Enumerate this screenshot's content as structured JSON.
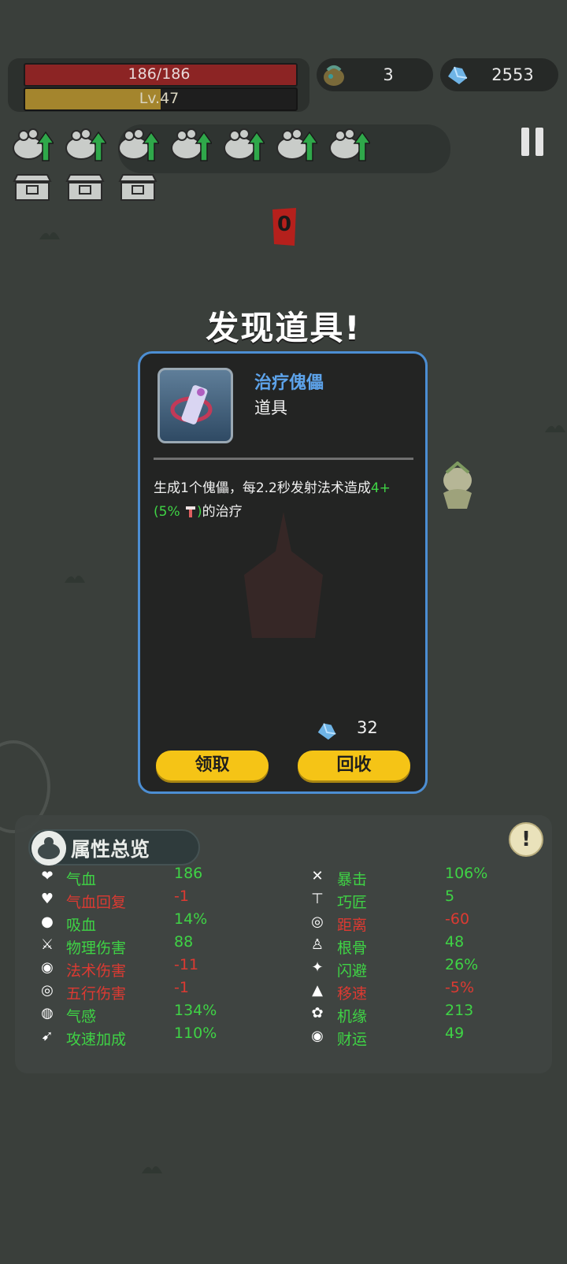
{
  "hud": {
    "hp_text": "186/186",
    "hp_fraction": 1.0,
    "level_text": "Lv.47",
    "level_progress": 0.5,
    "bag_count": "3",
    "crystals": "2553"
  },
  "counter_number": "0",
  "popup": {
    "title": "发现道具!",
    "item_name": "治疗傀儡",
    "item_type": "道具",
    "desc_part1": "生成1个傀儡，每2.2秒发射法术造成",
    "desc_green1": "4+",
    "desc_green2": "(5% ",
    "desc_green3": ")",
    "desc_part2": "的治疗",
    "cost": "32",
    "btn_take": "领取",
    "btn_recycle": "回收"
  },
  "stats": {
    "title": "属性总览",
    "left": [
      {
        "label": "气血",
        "value": "186",
        "color": "#3fd345",
        "icon": "heart-icon"
      },
      {
        "label": "气血回复",
        "value": "-1",
        "color": "#dc3a32",
        "icon": "heart-regen-icon"
      },
      {
        "label": "吸血",
        "value": "14%",
        "color": "#3fd345",
        "icon": "blood-drop-icon"
      },
      {
        "label": "物理伤害",
        "value": "88",
        "color": "#3fd345",
        "icon": "sword-icon"
      },
      {
        "label": "法术伤害",
        "value": "-11",
        "color": "#dc3a32",
        "icon": "spiral-icon"
      },
      {
        "label": "五行伤害",
        "value": "-1",
        "color": "#dc3a32",
        "icon": "element-icon"
      },
      {
        "label": "气感",
        "value": "134%",
        "color": "#3fd345",
        "icon": "qi-icon"
      },
      {
        "label": "攻速加成",
        "value": "110%",
        "color": "#3fd345",
        "icon": "attack-speed-icon"
      }
    ],
    "right": [
      {
        "label": "暴击",
        "value": "106%",
        "color": "#3fd345",
        "icon": "crit-icon"
      },
      {
        "label": "巧匠",
        "value": "5",
        "color": "#3fd345",
        "icon": "hammer-icon"
      },
      {
        "label": "距离",
        "value": "-60",
        "color": "#dc3a32",
        "icon": "range-icon"
      },
      {
        "label": "根骨",
        "value": "48",
        "color": "#3fd345",
        "icon": "meditate-icon"
      },
      {
        "label": "闪避",
        "value": "26%",
        "color": "#3fd345",
        "icon": "dodge-icon"
      },
      {
        "label": "移速",
        "value": "-5%",
        "color": "#dc3a32",
        "icon": "boot-icon"
      },
      {
        "label": "机缘",
        "value": "213",
        "color": "#3fd345",
        "icon": "fortune-cycle-icon"
      },
      {
        "label": "财运",
        "value": "49",
        "color": "#3fd345",
        "icon": "coin-icon"
      }
    ]
  }
}
